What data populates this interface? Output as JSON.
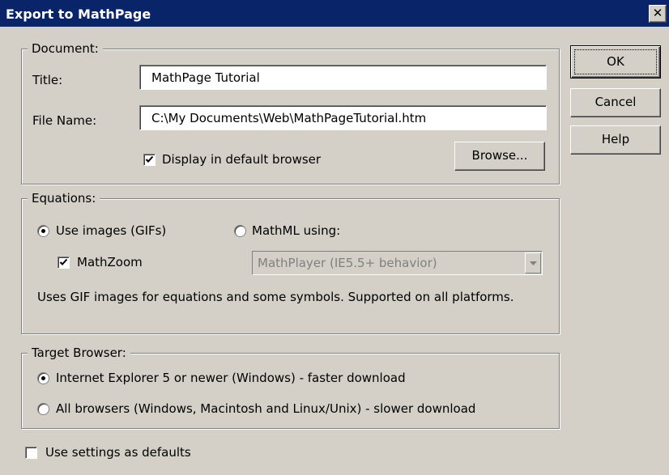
{
  "window": {
    "title": "Export to MathPage",
    "close_glyph": "✕"
  },
  "document_group": {
    "legend": "Document:",
    "title_label": "Title:",
    "title_value": "MathPage Tutorial",
    "file_name_label": "File Name:",
    "file_name_value": "C:\\My Documents\\Web\\MathPageTutorial.htm",
    "display_checkbox": {
      "label": "Display in default browser",
      "checked": true
    },
    "browse_label": "Browse..."
  },
  "equations_group": {
    "legend": "Equations:",
    "use_images": {
      "label": "Use images (GIFs)",
      "selected": true
    },
    "mathml": {
      "label": "MathML using:",
      "selected": false
    },
    "mathzoom": {
      "label": "MathZoom",
      "checked": true
    },
    "mathml_select": {
      "value": "MathPlayer (IE5.5+ behavior)",
      "disabled": true
    },
    "description": "Uses GIF images for equations and some symbols. Supported on all platforms."
  },
  "target_group": {
    "legend": "Target Browser:",
    "ie5": {
      "label": "Internet Explorer 5 or newer (Windows) - faster download",
      "selected": true
    },
    "all": {
      "label": "All browsers (Windows, Macintosh and Linux/Unix) - slower download",
      "selected": false
    }
  },
  "defaults_checkbox": {
    "label": "Use settings as defaults",
    "checked": false
  },
  "buttons": {
    "ok": "OK",
    "cancel": "Cancel",
    "help": "Help"
  },
  "colors": {
    "titlebar": "#0a246a",
    "face": "#d4d0c8",
    "shadow": "#808080",
    "disabled_text": "#808080"
  }
}
